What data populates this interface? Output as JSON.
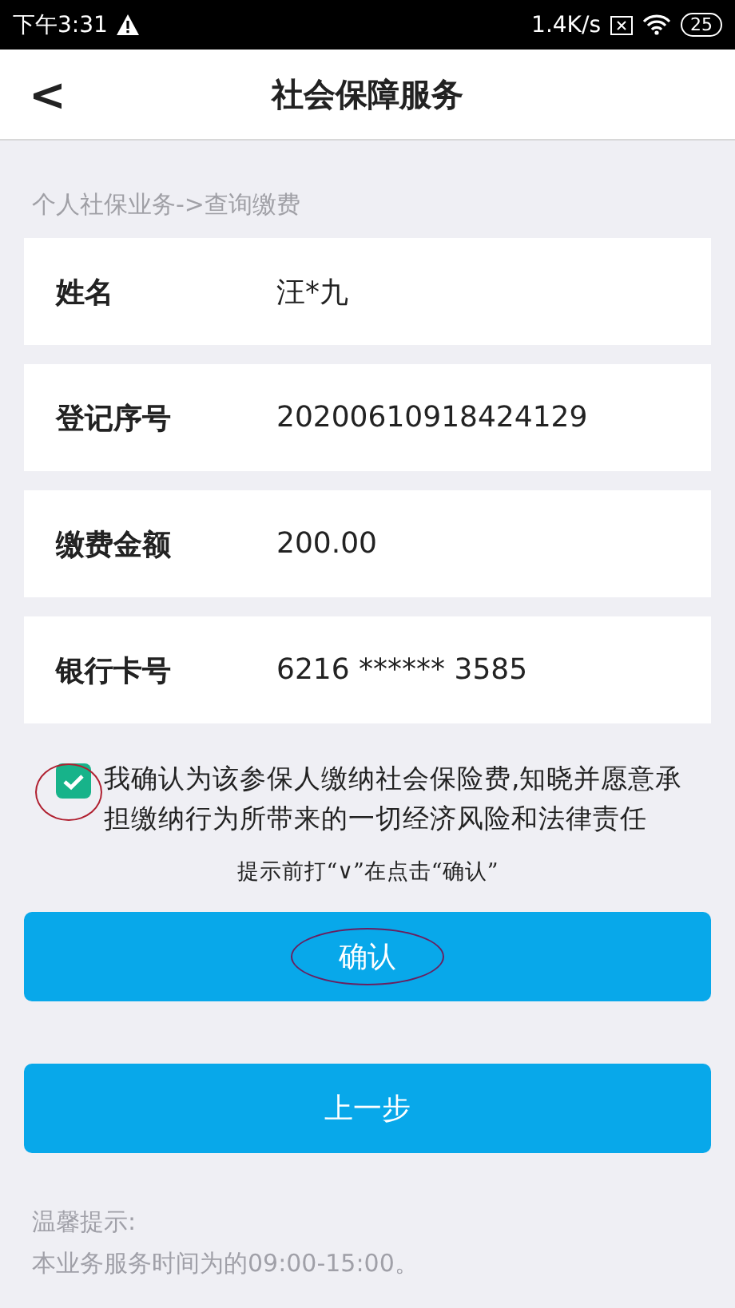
{
  "status_bar": {
    "time": "下午3:31",
    "speed": "1.4K/s",
    "battery": "25"
  },
  "header": {
    "back": "<",
    "title": "社会保障服务"
  },
  "breadcrumb": "个人社保业务->查询缴费",
  "fields": [
    {
      "label": "姓名",
      "value": "汪*九"
    },
    {
      "label": "登记序号",
      "value": "20200610918424129"
    },
    {
      "label": "缴费金额",
      "value": "200.00"
    },
    {
      "label": "银行卡号",
      "value": "6216 ****** 3585"
    }
  ],
  "agreement": {
    "checked": true,
    "circled": true,
    "text": "我确认为该参保人缴纳社会保险费,知晓并愿意承担缴纳行为所带来的一切经济风险和法律责任"
  },
  "hint": "提示前打“∨”在点击“确认”",
  "buttons": [
    {
      "label": "确认",
      "circled": true
    },
    {
      "label": "上一步",
      "circled": false
    }
  ],
  "notice": {
    "title": "温馨提示:",
    "text": "本业务服务时间为的09:00-15:00。"
  }
}
